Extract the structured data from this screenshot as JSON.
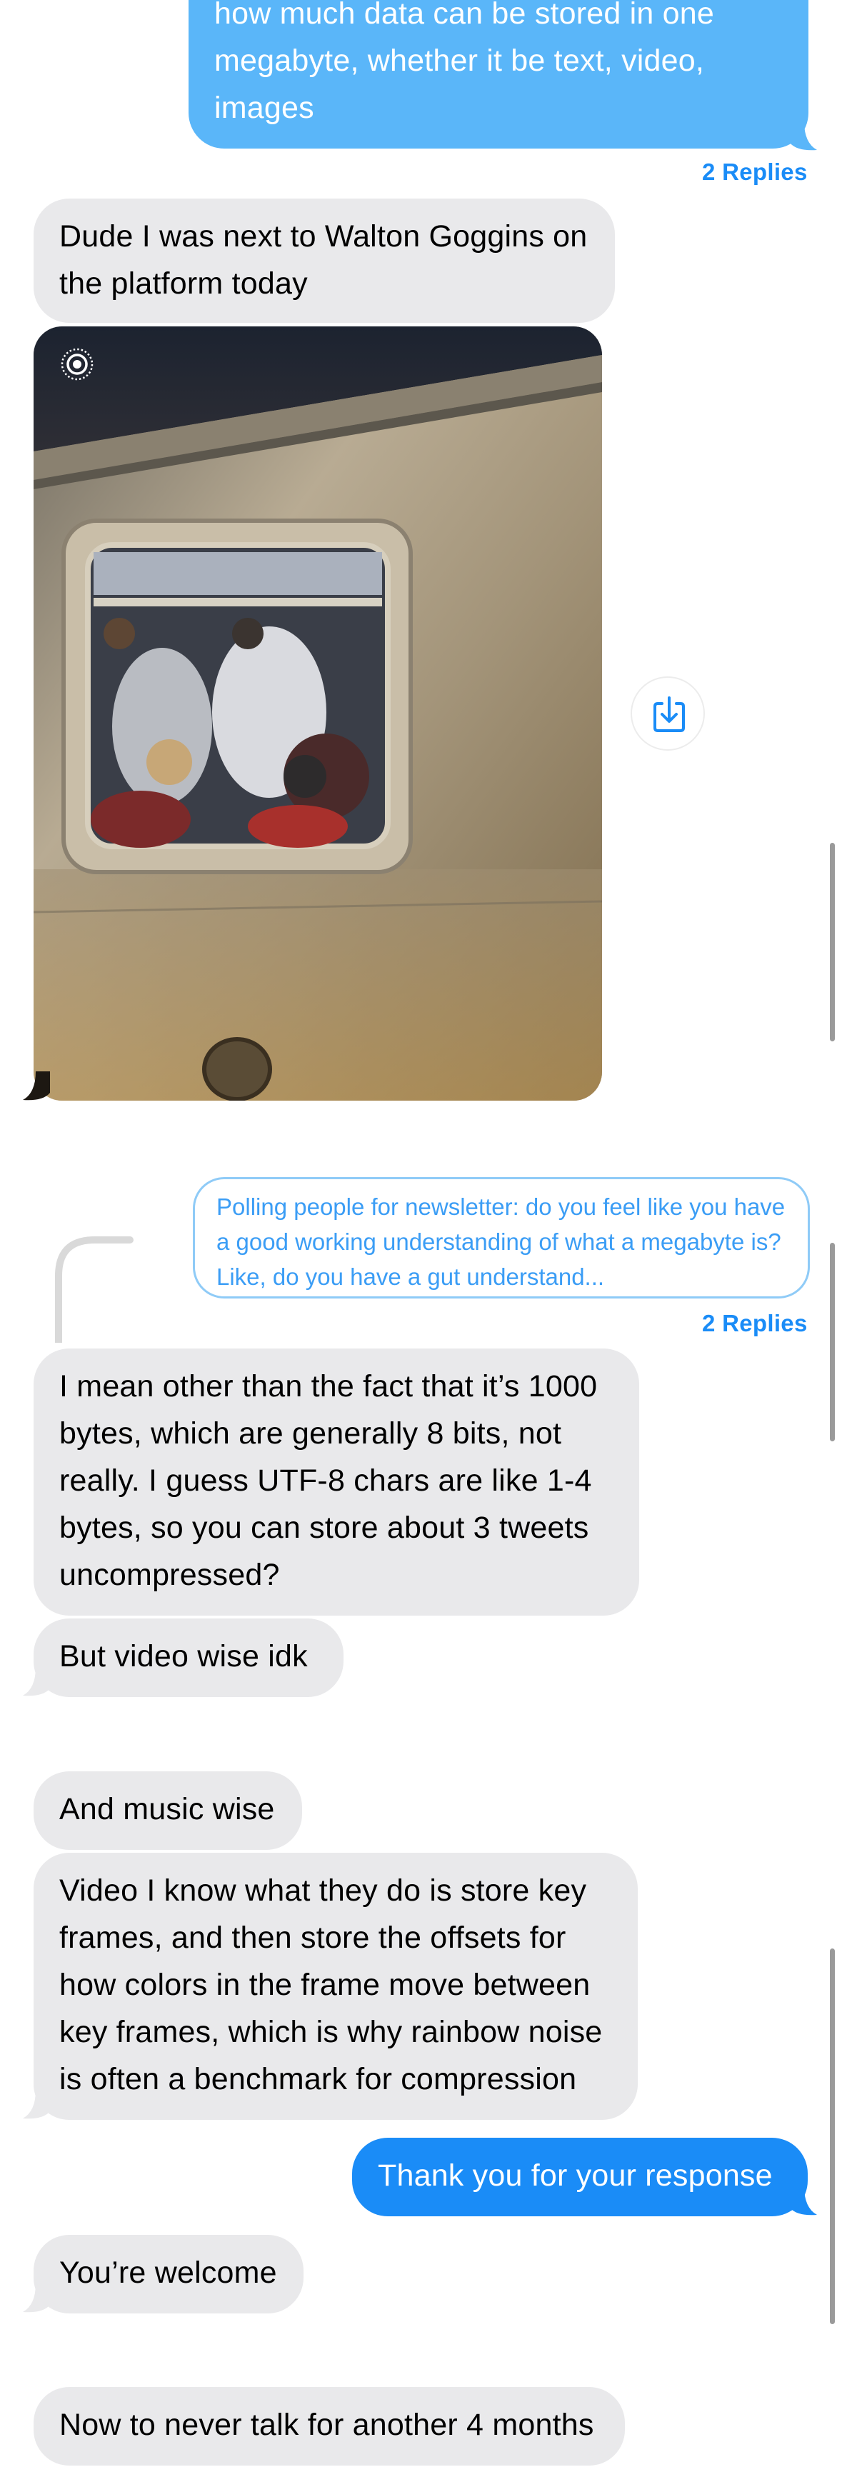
{
  "messages": {
    "m1": "how much data can be stored in one megabyte, whether it be text, video, images",
    "m1_replies": "2 Replies",
    "m2": "Dude I was next to Walton Goggins on the platform today",
    "quote": "Polling people for newsletter: do you feel like you have a good working understanding of what a megabyte is? Like, do you have a gut understand...",
    "quote_replies": "2 Replies",
    "m3": "I mean other than the fact that it’s 1000 bytes, which are generally 8 bits, not really. I guess UTF-8 chars are like 1-4 bytes, so you can store about 3 tweets uncompressed?",
    "m4": "But video wise idk",
    "m5": "And music wise",
    "m6": "Video I know what they do is store key frames, and then store the offsets for how colors in the frame move between key frames, which is why rainbow noise is often a benchmark for compression",
    "m7": "Thank you for your response",
    "m8": "You’re welcome",
    "m9": "Now to never talk for another 4 months"
  },
  "colors": {
    "outgoing": "#1a8cf7",
    "incoming": "#e9e9eb",
    "link": "#1a8cf7"
  },
  "icons": {
    "live_photo": "live-photo-icon",
    "save": "save-download-icon"
  }
}
